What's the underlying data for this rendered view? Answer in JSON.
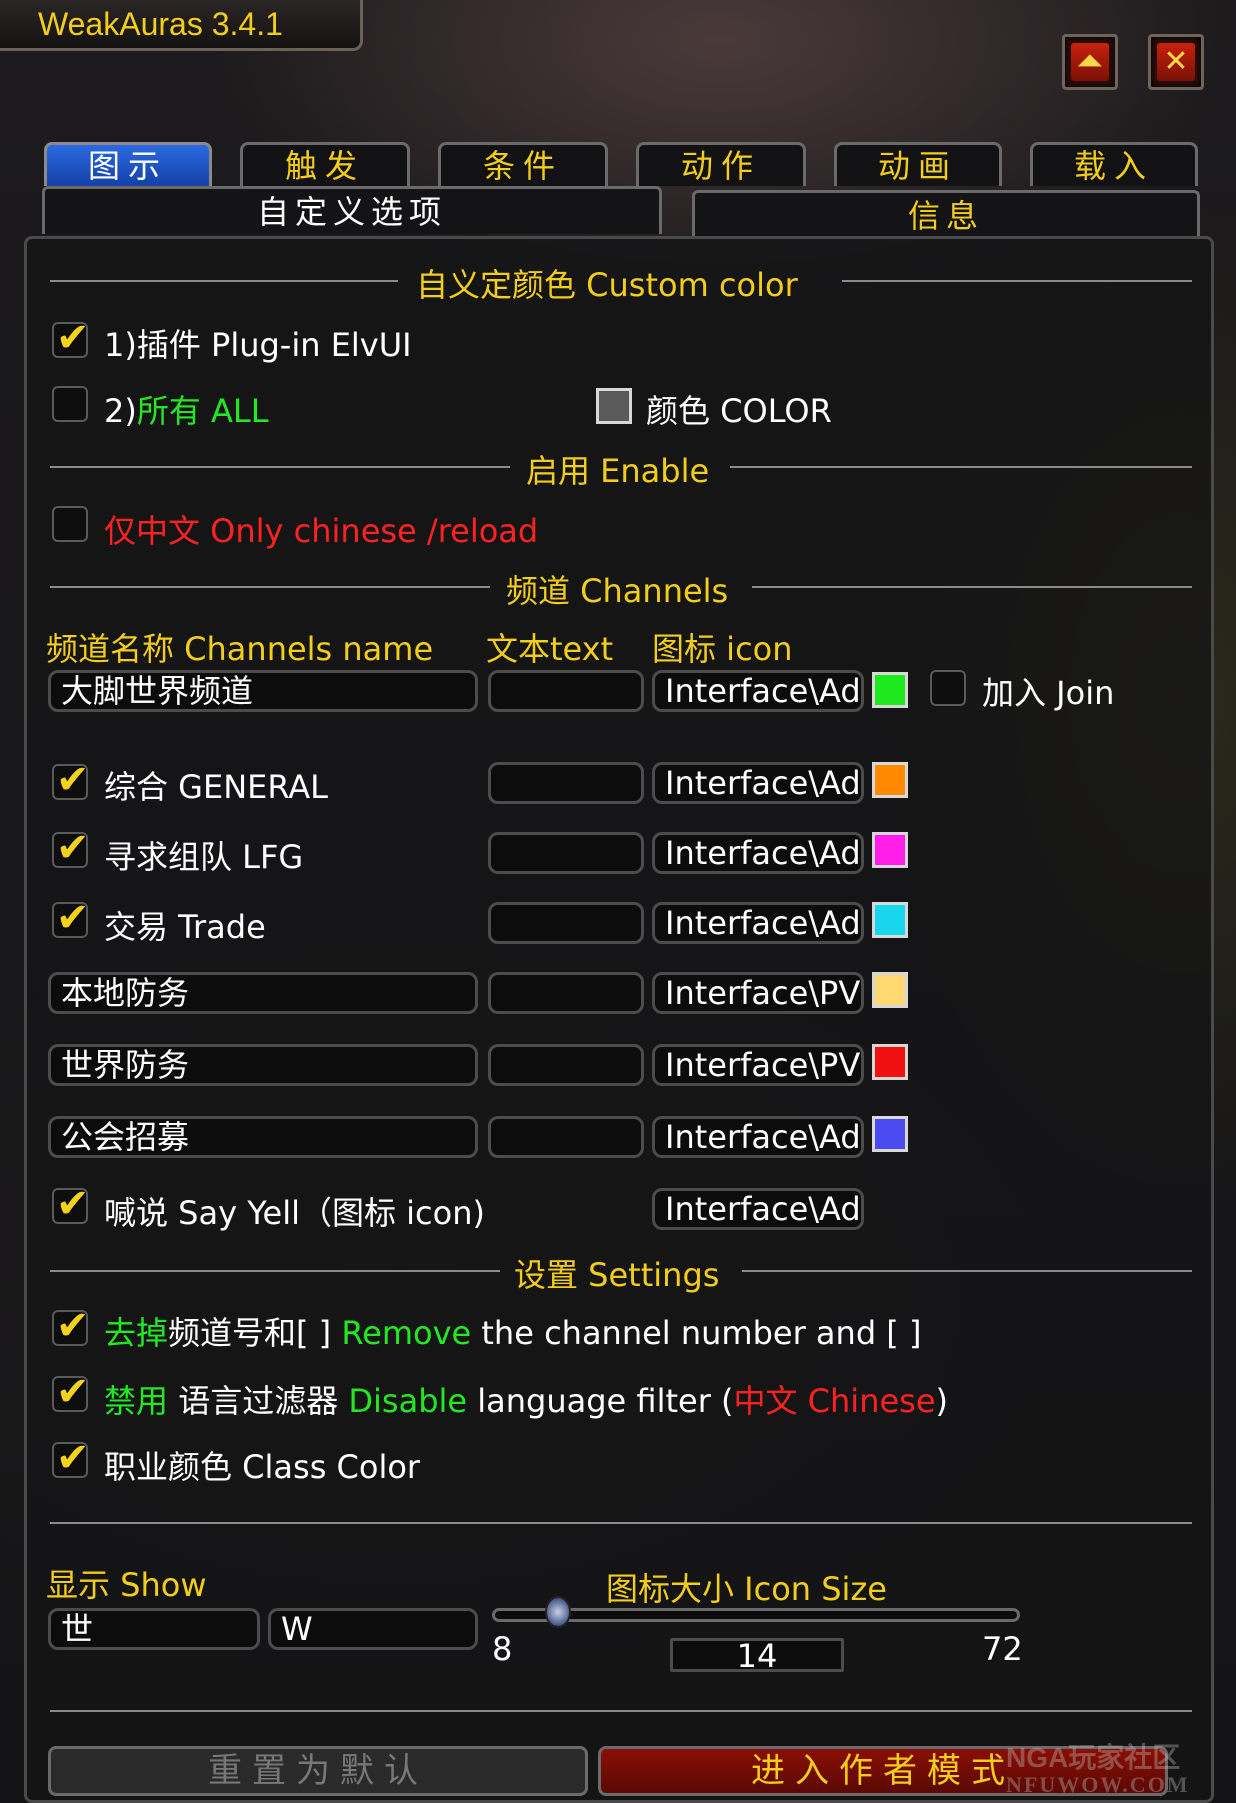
{
  "window": {
    "title": "WeakAuras 3.4.1",
    "minimize_icon": "collapse-icon",
    "close_icon": "close-icon"
  },
  "tabs": [
    "图示",
    "触发",
    "条件",
    "动作",
    "动画",
    "载入"
  ],
  "subtabs": [
    "自定义选项",
    "信息"
  ],
  "custom_color": {
    "header": "自义定颜色 Custom color",
    "plugin": {
      "label": "1)插件 Plug-in ElvUI",
      "checked": true
    },
    "all": {
      "prefix": "2)",
      "label": "所有 ALL",
      "checked": false
    },
    "color_label": "颜色 COLOR",
    "color_value": "#5a5a5a"
  },
  "enable": {
    "header": "启用 Enable",
    "only_chinese": {
      "label": "仅中文 Only chinese /reload",
      "checked": false
    }
  },
  "channels": {
    "header": "频道 Channels",
    "col_name": "频道名称 Channels name",
    "col_text": "文本text",
    "col_icon": "图标 icon",
    "join_label": "加入 Join",
    "rows": [
      {
        "type": "input",
        "name": "大脚世界频道",
        "text": "",
        "icon": "Interface\\Ad",
        "color": "#1ee81e"
      },
      {
        "type": "check",
        "name": "综合 GENERAL",
        "text": "",
        "icon": "Interface\\Ad",
        "color": "#ff8a00",
        "checked": true
      },
      {
        "type": "check",
        "name": "寻求组队 LFG",
        "text": "",
        "icon": "Interface\\Ad",
        "color": "#ff1ee8",
        "checked": true
      },
      {
        "type": "check",
        "name": "交易 Trade",
        "text": "",
        "icon": "Interface\\Ad",
        "color": "#18d6ee",
        "checked": true
      },
      {
        "type": "input",
        "name": "本地防务",
        "text": "",
        "icon": "Interface\\PV",
        "color": "#ffd870"
      },
      {
        "type": "input",
        "name": "世界防务",
        "text": "",
        "icon": "Interface\\PV",
        "color": "#f01010"
      },
      {
        "type": "input",
        "name": "公会招募",
        "text": "",
        "icon": "Interface\\Ad",
        "color": "#4a4af0"
      }
    ],
    "say_yell": {
      "label": "喊说 Say Yell（图标 icon)",
      "icon": "Interface\\Ad",
      "checked": true
    }
  },
  "settings": {
    "header": "设置 Settings",
    "remove_channel": {
      "green": "去掉",
      "mid": "频道号和[ ] ",
      "green2": "Remove",
      "rest": " the channel number and [ ]",
      "checked": true
    },
    "disable_filter": {
      "green": "禁用",
      "mid": " 语言过滤器 ",
      "green2": "Disable",
      "rest": " language filter (",
      "red": "中文 Chinese",
      "end": ")",
      "checked": true
    },
    "class_color": {
      "label": "职业颜色 Class Color",
      "checked": true
    }
  },
  "show": {
    "label": "显示 Show",
    "value1": "世",
    "value2": "W"
  },
  "icon_size": {
    "label": "图标大小 Icon Size",
    "min": "8",
    "max": "72",
    "value": "14",
    "fraction": 0.094
  },
  "footer": {
    "reset": "重置为默认",
    "author_mode": "进入作者模式"
  },
  "watermark": {
    "top": "NGA玩家社区",
    "bottom": "NFUWOW.COM"
  }
}
